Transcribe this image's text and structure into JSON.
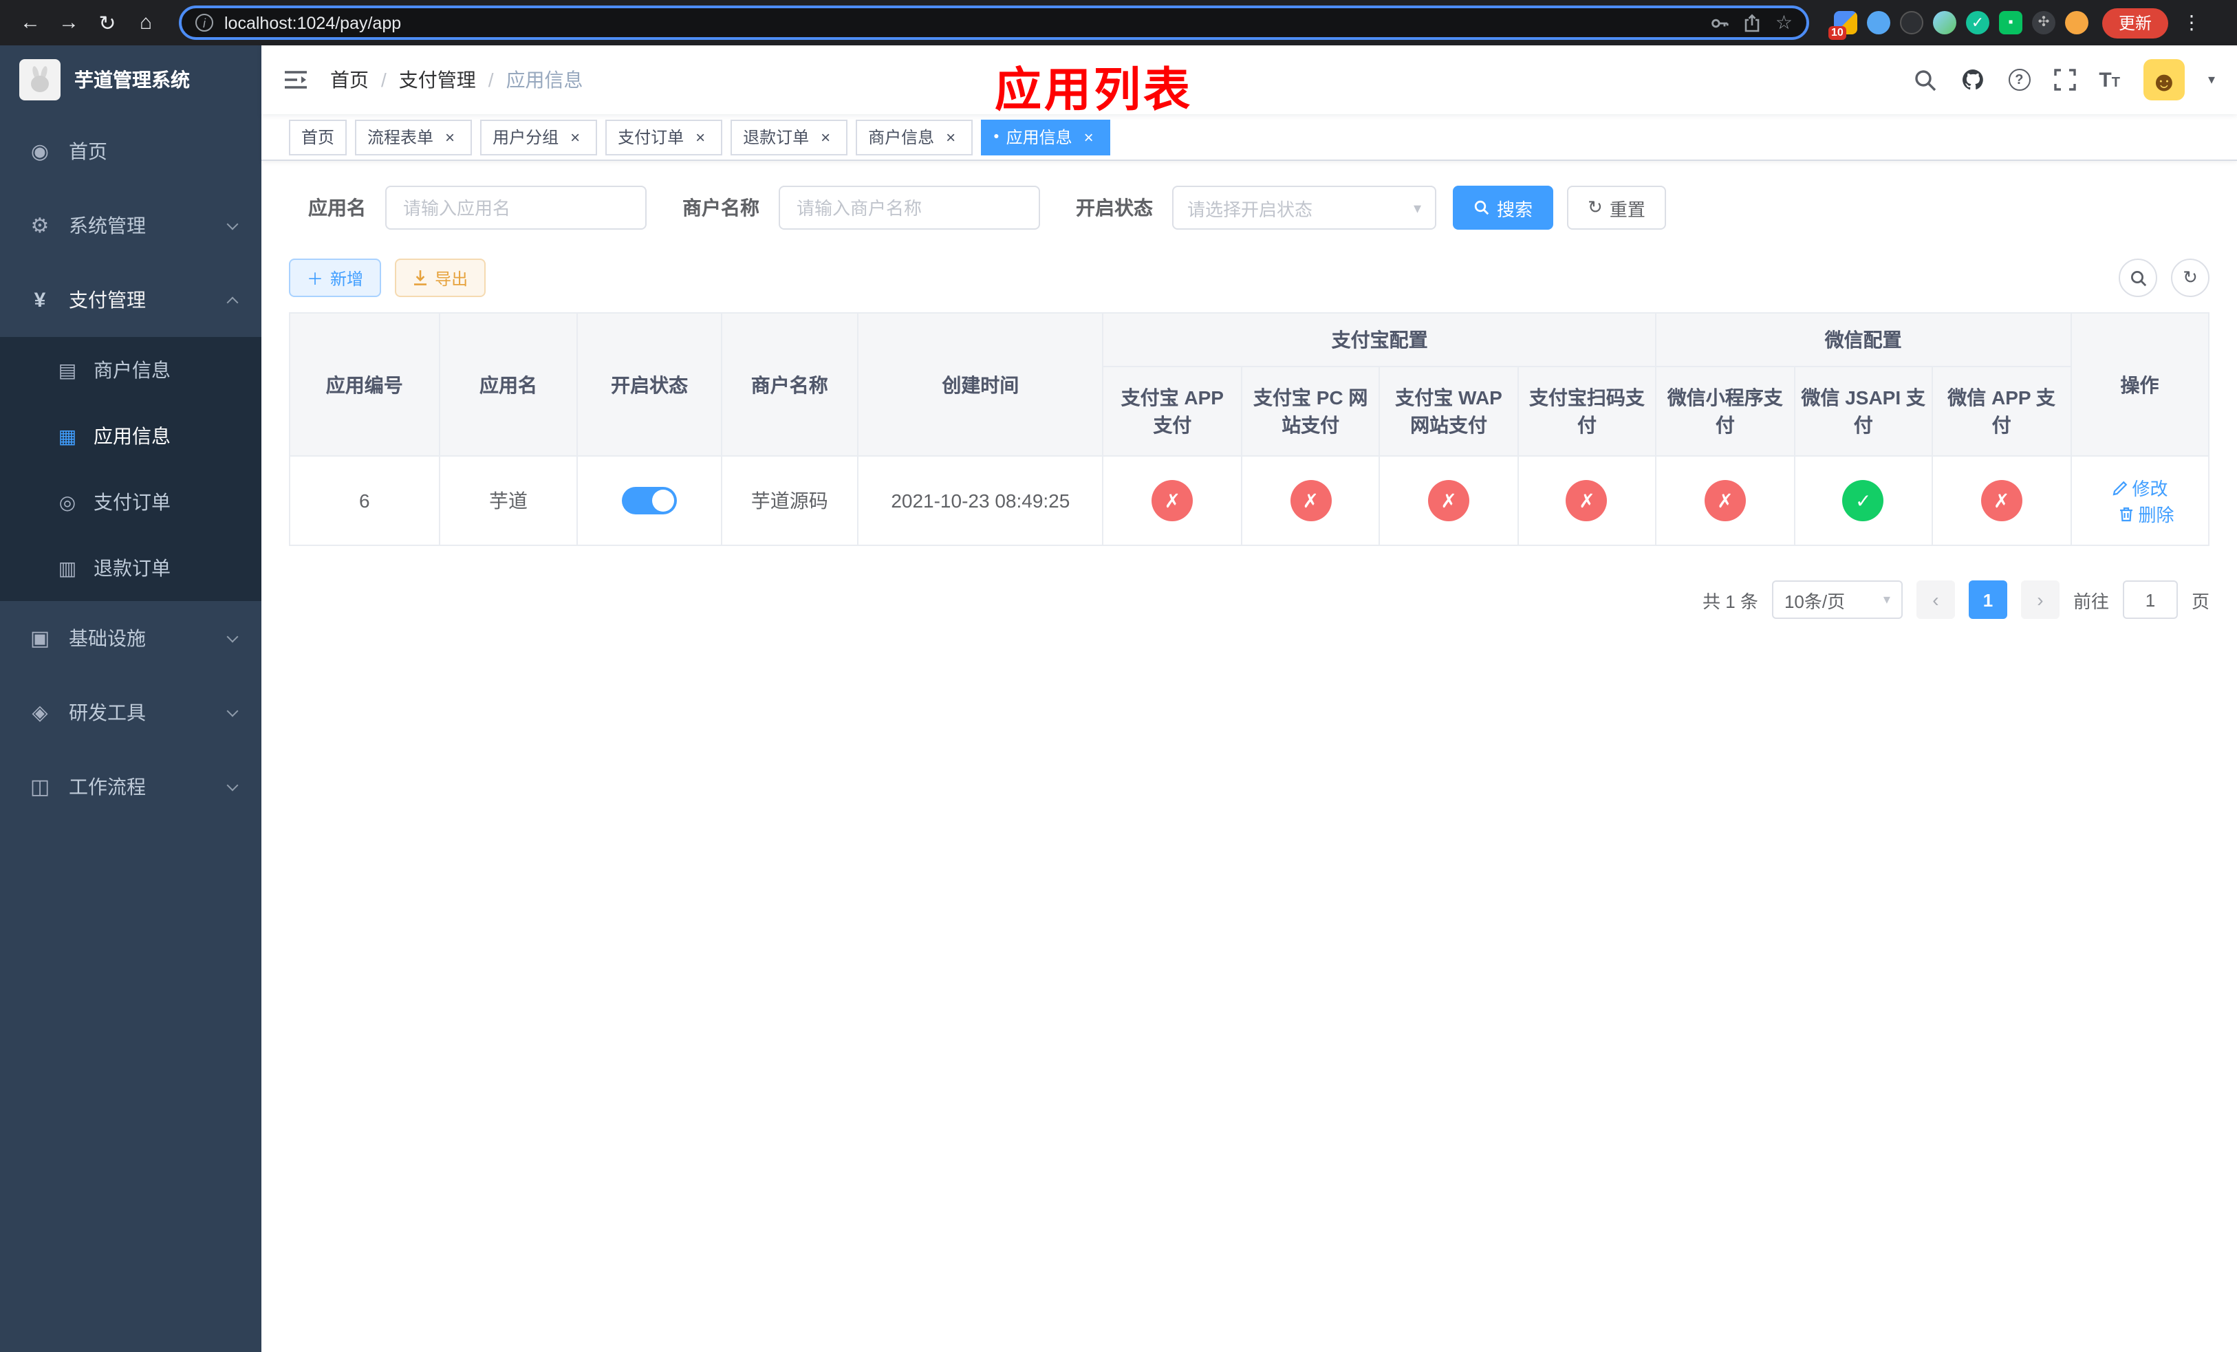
{
  "browser": {
    "url": "localhost:1024/pay/app",
    "update": "更新",
    "ext_badge": "10"
  },
  "icons": {
    "back": "←",
    "forward": "→",
    "reload": "↻",
    "home": "⌂",
    "star": "☆",
    "kebab": "⋮",
    "close": "×",
    "dot": "●",
    "sep": "/",
    "caret": "▾",
    "check": "✓",
    "cross": "✗",
    "plus": "＋",
    "refresh": "↻",
    "question": "?",
    "info": "i",
    "prev": "‹",
    "next": "›",
    "font_big": "T",
    "font_small": "T"
  },
  "menu_icons": {
    "home": "◉",
    "system": "⚙",
    "pay": "¥",
    "merchant": "▤",
    "app": "▦",
    "order": "◎",
    "refund": "▥",
    "infra": "▣",
    "devtool": "◈",
    "workflow": "◫"
  },
  "sidebar": {
    "title": "芋道管理系统",
    "items": [
      {
        "label": "首页"
      },
      {
        "label": "系统管理"
      },
      {
        "label": "支付管理"
      },
      {
        "label": "商户信息"
      },
      {
        "label": "应用信息"
      },
      {
        "label": "支付订单"
      },
      {
        "label": "退款订单"
      },
      {
        "label": "基础设施"
      },
      {
        "label": "研发工具"
      },
      {
        "label": "工作流程"
      }
    ]
  },
  "header": {
    "breadcrumb": [
      "首页",
      "支付管理",
      "应用信息"
    ],
    "overlay_title": "应用列表"
  },
  "tabs": [
    {
      "label": "首页"
    },
    {
      "label": "流程表单"
    },
    {
      "label": "用户分组"
    },
    {
      "label": "支付订单"
    },
    {
      "label": "退款订单"
    },
    {
      "label": "商户信息"
    },
    {
      "label": "应用信息"
    }
  ],
  "filters": {
    "app_name_label": "应用名",
    "app_name_placeholder": "请输入应用名",
    "merchant_label": "商户名称",
    "merchant_placeholder": "请输入商户名称",
    "status_label": "开启状态",
    "status_placeholder": "请选择开启状态",
    "search": "搜索",
    "reset": "重置"
  },
  "toolbar": {
    "add": "新增",
    "export": "导出"
  },
  "table": {
    "group_alipay": "支付宝配置",
    "group_wechat": "微信配置",
    "col_id": "应用编号",
    "col_name": "应用名",
    "col_status": "开启状态",
    "col_merchant": "商户名称",
    "col_created": "创建时间",
    "col_actions": "操作",
    "sub_cols": [
      "支付宝 APP 支付",
      "支付宝 PC 网站支付",
      "支付宝 WAP 网站支付",
      "支付宝扫码支付",
      "微信小程序支付",
      "微信 JSAPI 支付",
      "微信 APP 支付"
    ],
    "row": {
      "id": "6",
      "name": "芋道",
      "enabled": true,
      "merchant": "芋道源码",
      "created": "2021-10-23 08:49:25",
      "configs": [
        "no",
        "no",
        "no",
        "no",
        "no",
        "yes",
        "no"
      ],
      "edit": "修改",
      "delete": "删除"
    }
  },
  "pagination": {
    "total": "共 1 条",
    "size": "10条/页",
    "page": "1",
    "goto": "前往",
    "goto_value": "1",
    "unit": "页"
  },
  "colors": {
    "accent": "#409eff",
    "danger": "#f56c6c",
    "success": "#13ce66",
    "warning": "#e6a23c",
    "overlay_title": "#fe0000",
    "sidebar": "#304156",
    "submenu": "#1f2d3d"
  }
}
